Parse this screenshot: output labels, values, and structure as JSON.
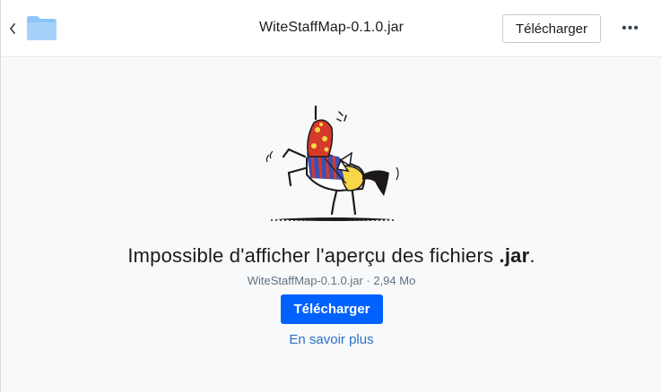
{
  "header": {
    "back_icon": "chevron-left-icon",
    "folder_icon": "folder-icon",
    "file_name": "WiteStaffMap-0.1.0.jar",
    "download_label": "Télécharger",
    "more_icon": "more-horizontal-icon",
    "more_label": "•••"
  },
  "preview": {
    "illustration": "unicorn-illustration",
    "message_prefix": "Impossible d'afficher l'aperçu des fichiers ",
    "message_ext": ".jar",
    "message_suffix": ".",
    "file_meta": "WiteStaffMap-0.1.0.jar · 2,94 Mo",
    "download_label": "Télécharger",
    "learn_more_label": "En savoir plus"
  },
  "colors": {
    "accent": "#0061fe",
    "folder": "#8ec5f9",
    "background": "#f7f9fa"
  }
}
